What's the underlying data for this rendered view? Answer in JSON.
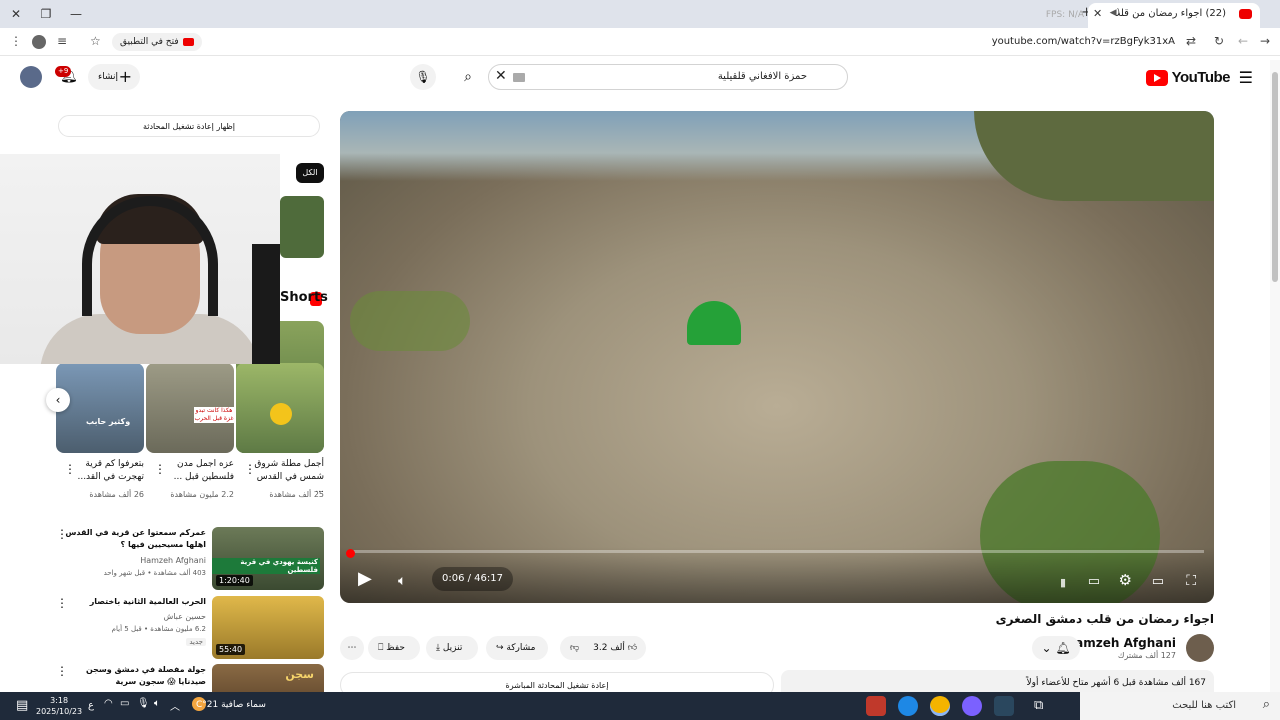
{
  "browser": {
    "tab_title": "(22) اجواء رمضان من قلب...",
    "fps_label": "FPS: N/A",
    "url": "youtube.com/watch?v=rzBgFyk31xA",
    "open_in_app": "فتح في التطبيق"
  },
  "youtube_header": {
    "logo_text": "YouTube",
    "search_query": "حمزة الافغاني قلقيلية",
    "create_label": "إنشاء",
    "notification_count": "+9"
  },
  "player": {
    "time": "0:06 / 46:17",
    "progress_fraction": 0.002
  },
  "video": {
    "title": "اجواء رمضان من قلب دمشق الصغرى",
    "channel": "Hamzeh Afghani",
    "subscribers": "127 ألف مشترك",
    "likes": "3.2 ألف",
    "share_label": "مشاركة",
    "download_label": "تنزيل",
    "save_label": "حفظ",
    "description_meta": "167 ألف مشاهدة  قبل 6 أشهر  متاح للأعضاء أولاً",
    "live_chat_replay": "إعادة تشغيل المحادثة المباشرة"
  },
  "sidebar": {
    "replay_chat_label": "إظهار إعادة تشغيل المحادثة",
    "chip_all": "الكل",
    "shorts_label": "Shorts",
    "shorts": [
      {
        "title": "أجمل مطلة شروق شمس في القدس ...",
        "views": "25 ألف مشاهدة",
        "thumb_text": "",
        "color": "#8a9b5c"
      },
      {
        "title": "عزه اجمل مدن فلسطين قبل ...",
        "views": "2.2 مليون مشاهدة",
        "thumb_text": "هكذا كانت تبدو غزة قبل الحرب",
        "color": "#8f8c7a"
      },
      {
        "title": "بتعرفوا كم قرية تهجرت في القد...",
        "views": "26 ألف مشاهدة",
        "thumb_text": "وكثير حابب",
        "color": "#5e7a9c"
      }
    ],
    "recommended": [
      {
        "title": "عمركم سمعتوا عن قرية في القدس اهلها مسيحيين فيها ؟",
        "channel": "Hamzeh Afghani",
        "meta": "403 ألف مشاهدة • قبل شهر واحد",
        "duration": "1:20:40",
        "badge": "",
        "thumb_text": "كنيسة يهودي في قرية فلسطين",
        "color": "#5b6b4a"
      },
      {
        "title": "الحرب العالمية الثانية باختصار",
        "channel": "حسين عباش",
        "meta": "6.2 مليون مشاهدة • قبل 5 أيام",
        "duration": "55:40",
        "badge": "جديد",
        "thumb_text": "",
        "color": "#c9a646"
      },
      {
        "title": "جولة مفصلة في دمشق وسجن صيدنايا 😱 سجون سرية",
        "channel": "",
        "meta": "",
        "duration": "",
        "badge": "",
        "thumb_text": "سجن",
        "color": "#7a5a3a"
      }
    ]
  },
  "taskbar": {
    "search_placeholder": "اكتب هنا للبحث",
    "weather": "سماء صافية  21°C",
    "time": "3:18",
    "date": "2025/10/23",
    "lang": "ع"
  }
}
